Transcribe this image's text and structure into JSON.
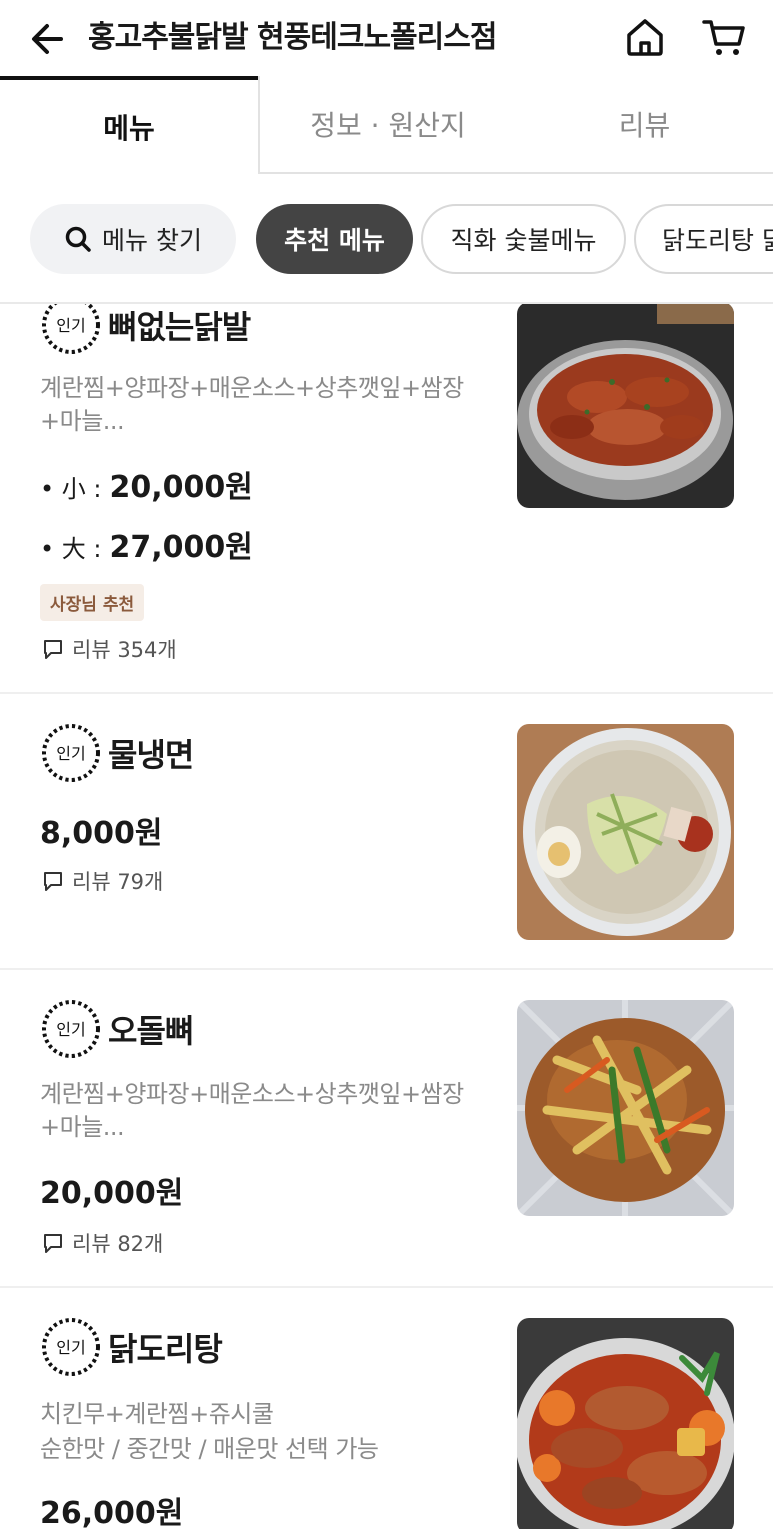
{
  "header": {
    "title": "홍고추불닭발 현풍테크노폴리스점",
    "back_icon": "arrow-left-icon",
    "home_icon": "home-icon",
    "cart_icon": "cart-icon"
  },
  "tabs": [
    {
      "label": "메뉴",
      "active": true
    },
    {
      "label": "정보 · 원산지",
      "active": false
    },
    {
      "label": "리뷰",
      "active": false
    }
  ],
  "chips": {
    "search_label": "메뉴 찾기",
    "items": [
      "추천 메뉴",
      "직화 숯불메뉴",
      "닭도리탕 닭"
    ]
  },
  "popular_badge_label": "인기",
  "menu": [
    {
      "name": "뼈없는닭발",
      "description": "계란찜+양파장+매운소스+상추깻잎+쌈장+마늘...",
      "prices": [
        {
          "label": "• 小 :",
          "value": "20,000원"
        },
        {
          "label": "• 大 :",
          "value": "27,000원"
        }
      ],
      "owner_badge": "사장님 추천",
      "review": "리뷰 354개"
    },
    {
      "name": "물냉면",
      "price": "8,000원",
      "review": "리뷰 79개"
    },
    {
      "name": "오돌뼈",
      "description": "계란찜+양파장+매운소스+상추깻잎+쌈장+마늘...",
      "price": "20,000원",
      "review": "리뷰 82개"
    },
    {
      "name": "닭도리탕",
      "description_lines": [
        "치킨무+계란찜+쥬시쿨",
        "순한맛 / 중간맛 / 매운맛 선택 가능"
      ],
      "price": "26,000원"
    }
  ],
  "colors": {
    "active_chip": "#444444",
    "owner_badge_bg": "#f5ede6",
    "owner_badge_text": "#8b5a3c",
    "muted_text": "#8a8a8a"
  }
}
